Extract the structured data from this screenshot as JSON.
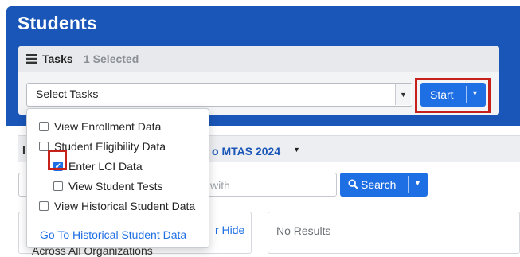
{
  "page": {
    "title": "Students"
  },
  "tasks": {
    "title": "Tasks",
    "count_label": "1 Selected",
    "select_value": "Select Tasks",
    "start_label": "Start"
  },
  "task_menu": {
    "items": [
      {
        "label": "View Enrollment Data",
        "checked": false,
        "indent": 0
      },
      {
        "label": "Student Eligibility Data",
        "checked": false,
        "indent": 0
      },
      {
        "label": "Enter LCI Data",
        "checked": true,
        "indent": 1
      },
      {
        "label": "View Student Tests",
        "checked": false,
        "indent": 1
      },
      {
        "label": "View Historical Student Data",
        "checked": false,
        "indent": 0
      }
    ],
    "footer_link": "Go To Historical Student Data"
  },
  "filter": {
    "left_text": "I",
    "admin_label": "o MTAS 2024"
  },
  "search": {
    "input_text": "with",
    "button_label": "Search"
  },
  "left_panel": {
    "hide_label": "r Hide",
    "scope_text": "Across All Organizations"
  },
  "results": {
    "empty_text": "No Results"
  },
  "colors": {
    "header_blue": "#1a56b8",
    "button_blue": "#1f6fe4",
    "highlight_red": "#c4221b"
  }
}
